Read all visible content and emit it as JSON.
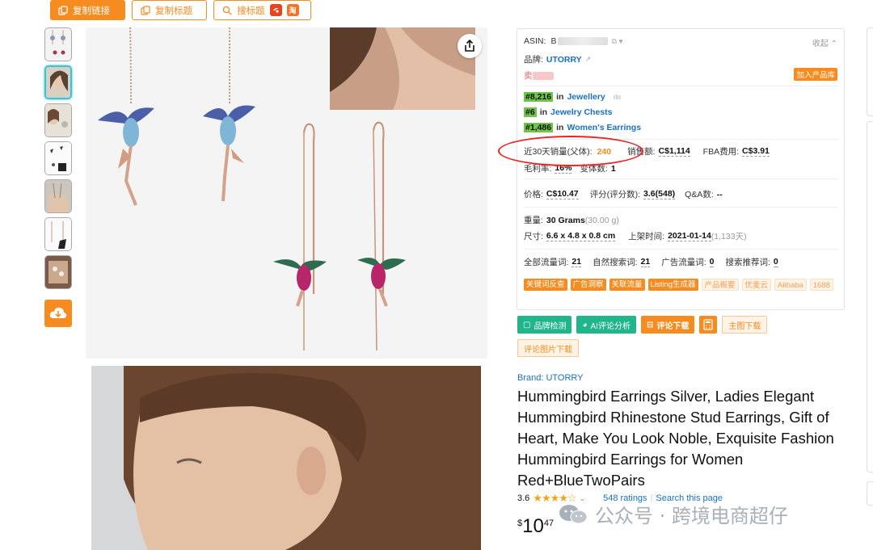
{
  "toolbar": {
    "copy_link": "复制链接",
    "copy_title": "复制标题",
    "search_title": "搜标题",
    "tao_badge": "淘"
  },
  "colors": {
    "accent": "#f68b1f",
    "link": "#1a6fc4",
    "rank_green": "#71c34a",
    "action_green": "#21b58b"
  },
  "info": {
    "asin_label": "ASIN:",
    "asin_prefix": "B",
    "collect": "收起",
    "brand_label": "品牌:",
    "brand_value": "UTORRY",
    "seller_prefix": "卖",
    "add_library": "加入产品库",
    "ranks": [
      {
        "rank": "#8,216",
        "in": "in",
        "category": "Jewellery"
      },
      {
        "rank": "#6",
        "in": "in",
        "category": "Jewelry Chests"
      },
      {
        "rank": "#1,486",
        "in": "in",
        "category": "Women's Earrings"
      }
    ],
    "sales_label": "近30天销量(父体):",
    "sales_value": "240",
    "revenue_label": "销售额:",
    "revenue_value": "C$1,114",
    "fba_label": "FBA费用:",
    "fba_value": "C$3.91",
    "margin_label": "毛利率:",
    "margin_value": "16%",
    "variants_label": "变体数:",
    "variants_value": "1",
    "price_label": "价格:",
    "price_value": "C$10.47",
    "rating_label": "评分(评分数):",
    "rating_value": "3.6(548)",
    "qa_label": "Q&A数:",
    "qa_value": "--",
    "weight_label": "重量:",
    "weight_value": "30 Grams",
    "weight_extra": "(30.00 g)",
    "size_label": "尺寸:",
    "size_value": "6.6 x 4.8 x 0.8 cm",
    "listed_label": "上架时间:",
    "listed_value": "2021-01-14",
    "listed_extra": "(1,133天)",
    "all_kw_label": "全部流量词:",
    "all_kw_value": "21",
    "organic_label": "自然搜索词:",
    "organic_value": "21",
    "ad_label": "广告流量词:",
    "ad_value": "0",
    "rec_label": "搜索推荐词:",
    "rec_value": "0",
    "chips_solid": [
      "关键词反查",
      "广告洞察",
      "关联流量",
      "Listing生成器"
    ],
    "chips_soft": [
      "产品概要",
      "优麦云",
      "Alibaba",
      "1688"
    ]
  },
  "actions": {
    "brand_check": "品牌检测",
    "ai_review": "AI评论分析",
    "review_download": "评论下载",
    "main_image_download": "主图下载",
    "review_image_download": "评论图片下载"
  },
  "product": {
    "brand_line": "Brand: UTORRY",
    "title": "Hummingbird Earrings Silver, Ladies Elegant Hummingbird Rhinestone Stud Earrings, Gift of Heart, Make You Look Noble, Exquisite Fashion Hummingbird Earrings for Women Red+BlueTwoPairs",
    "rating": "3.6",
    "stars_display": "★★★★☆",
    "ratings_count": "548 ratings",
    "separator": "|",
    "search_page": "Search this page",
    "price_currency": "$",
    "price_whole": "10",
    "price_cents": "47"
  },
  "watermark": {
    "text": "公众号 · 跨境电商超仔"
  }
}
